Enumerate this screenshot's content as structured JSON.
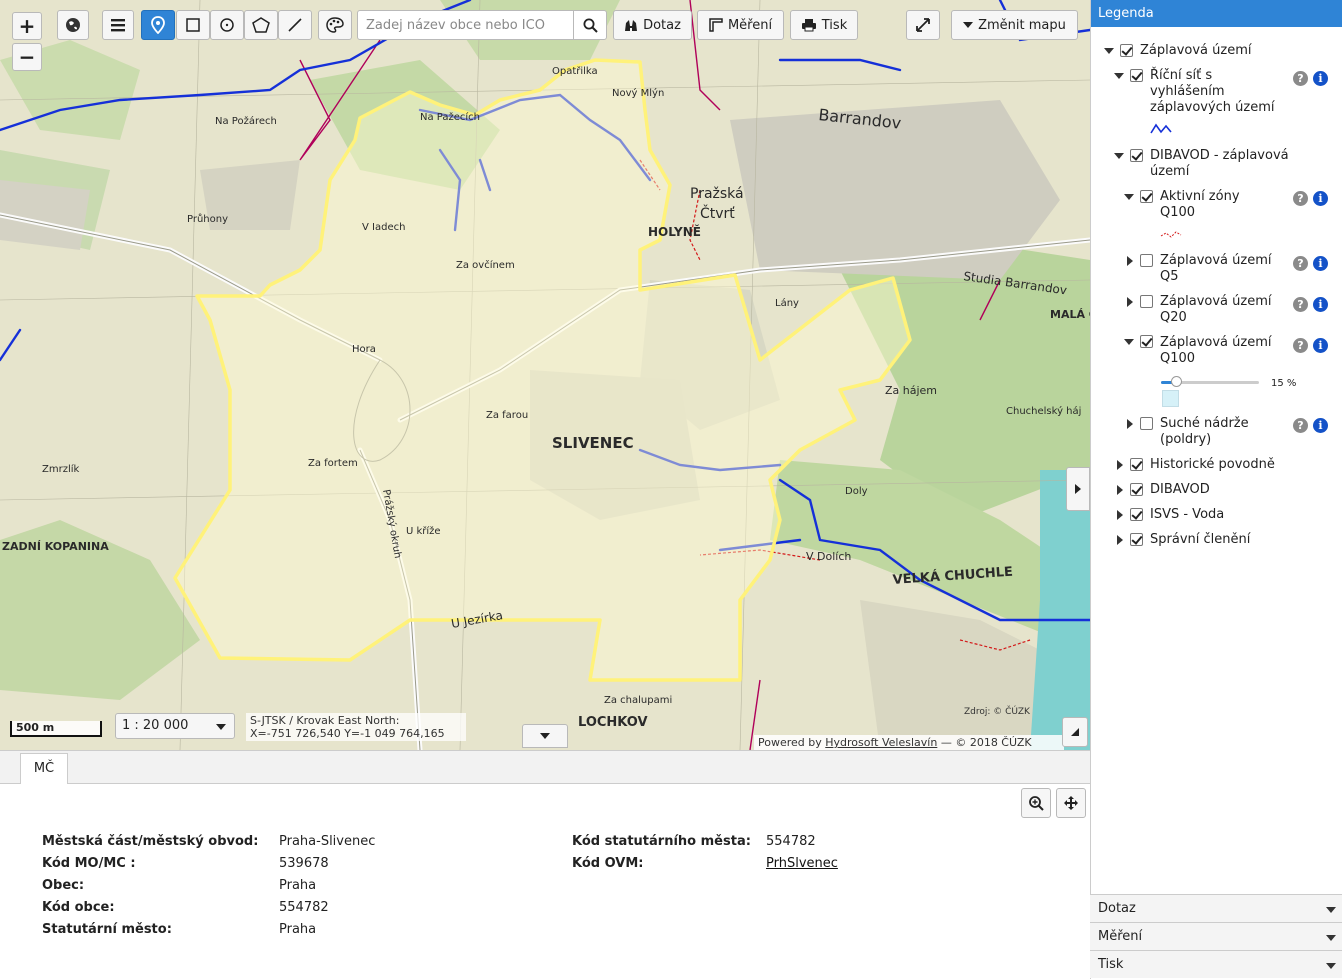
{
  "toolbar": {
    "zoom_in": "+",
    "zoom_out": "−",
    "search_placeholder": "Zadej název obce nebo ICO",
    "dotaz_label": "Dotaz",
    "mereni_label": "Měření",
    "tisk_label": "Tisk",
    "change_map_label": "Změnit mapu"
  },
  "map": {
    "place_labels": [
      "Na Požárech",
      "Průhony",
      "Zmrzlík",
      "ZADNÍ KOPANINA",
      "Hora",
      "Za farou",
      "SLIVENEC",
      "Za fortem",
      "U kříže",
      "U Jezírka",
      "LOCHKOV",
      "Za chalupami",
      "V Dolích",
      "VELKÁ CHUCHLE",
      "Doly",
      "Za hájem",
      "Chuchelský háj",
      "Lány",
      "Studia Barrandov",
      "Barrandov",
      "Pražská Čtvrť",
      "HOLYNĚ",
      "V Iadech",
      "Za ovčínem",
      "U Jezírka",
      "MALÁ CH",
      "Opatřilka",
      "Na Pažecích",
      "Nový Mlýn",
      "Prážský okruh"
    ],
    "scale_label": "500 m",
    "scale_value": "1 : 20 000",
    "coords_line1": "S-JTSK / Krovak East North:",
    "coords_line2": "X=-751 726,540 Y=-1 049 764,165",
    "attribution_prefix": "Powered by ",
    "attribution_link": "Hydrosoft Veleslavín",
    "attribution_suffix": " — © 2018 ČÚZK",
    "source_note": "Zdroj: © ČÚZK"
  },
  "info_panel": {
    "tab": "MČ",
    "left": [
      {
        "key": "Městská část/městský obvod:",
        "value": "Praha-Slivenec"
      },
      {
        "key": "Kód MO/MC :",
        "value": "539678"
      },
      {
        "key": "Obec:",
        "value": "Praha"
      },
      {
        "key": "Kód obce:",
        "value": "554782"
      },
      {
        "key": "Statutární město:",
        "value": "Praha"
      }
    ],
    "right": [
      {
        "key": "Kód statutárního města:",
        "value": "554782"
      },
      {
        "key": "Kód OVM:",
        "value": "PrhSlvenec"
      }
    ]
  },
  "legend": {
    "title": "Legenda",
    "items": [
      {
        "label": "Záplavová území",
        "checked": true
      },
      {
        "label": "Říční síť s vyhlášením záplavových území",
        "checked": true
      },
      {
        "label": "DIBAVOD - záplavová území",
        "checked": true
      },
      {
        "label": "Aktivní zóny Q100",
        "checked": true
      },
      {
        "label": "Záplavová území Q5",
        "checked": false
      },
      {
        "label": "Záplavová území Q20",
        "checked": false
      },
      {
        "label": "Záplavová území Q100",
        "checked": true
      },
      {
        "label": "Suché nádrže (poldry)",
        "checked": false
      },
      {
        "label": "Historické povodně",
        "checked": true
      },
      {
        "label": "DIBAVOD",
        "checked": true
      },
      {
        "label": "ISVS - Voda",
        "checked": true
      },
      {
        "label": "Správní členění",
        "checked": true
      }
    ],
    "opacity_label": "15 %",
    "opacity_value": 0.15,
    "accordion": [
      "Dotaz",
      "Měření",
      "Tisk"
    ]
  },
  "colors": {
    "accent": "#2f84d6",
    "boundary": "#fff27a",
    "river": "#1530d8",
    "district_border": "#b0005a"
  }
}
